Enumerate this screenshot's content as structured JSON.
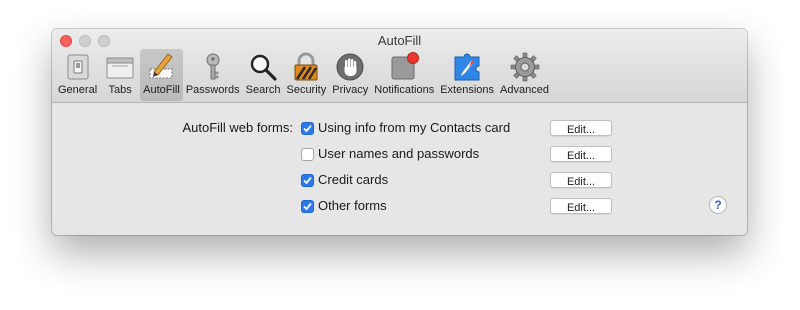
{
  "window": {
    "title": "AutoFill"
  },
  "toolbar": {
    "items": [
      {
        "label": "General",
        "icon": "general-icon"
      },
      {
        "label": "Tabs",
        "icon": "tabs-icon"
      },
      {
        "label": "AutoFill",
        "icon": "autofill-icon",
        "selected": true
      },
      {
        "label": "Passwords",
        "icon": "key-icon"
      },
      {
        "label": "Search",
        "icon": "magnifier-icon"
      },
      {
        "label": "Security",
        "icon": "lock-icon"
      },
      {
        "label": "Privacy",
        "icon": "hand-icon"
      },
      {
        "label": "Notifications",
        "icon": "notifications-icon"
      },
      {
        "label": "Extensions",
        "icon": "extensions-icon"
      },
      {
        "label": "Advanced",
        "icon": "gear-icon"
      }
    ]
  },
  "autofill": {
    "label": "AutoFill web forms:",
    "options": [
      {
        "text": "Using info from my Contacts card",
        "checked": true,
        "button": "Edit..."
      },
      {
        "text": "User names and passwords",
        "checked": false,
        "button": "Edit..."
      },
      {
        "text": "Credit cards",
        "checked": true,
        "button": "Edit..."
      },
      {
        "text": "Other forms",
        "checked": true,
        "button": "Edit..."
      }
    ]
  },
  "help": {
    "label": "?"
  },
  "colors": {
    "accent": "#2b79ec",
    "close": "#fc605c",
    "badge": "#e8382f"
  }
}
